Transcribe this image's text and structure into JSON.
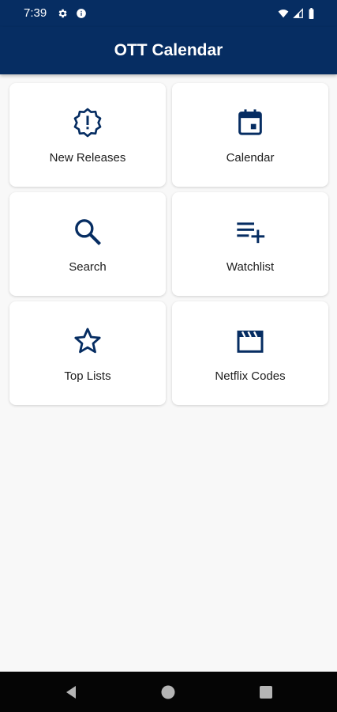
{
  "status_bar": {
    "time": "7:39",
    "left_icons": [
      "settings-icon",
      "info-icon"
    ],
    "right_icons": [
      "wifi-icon",
      "signal-icon",
      "battery-icon"
    ]
  },
  "app_bar": {
    "title": "OTT Calendar",
    "color": "#062d62"
  },
  "tiles": [
    {
      "label": "New Releases",
      "icon": "new-releases-icon"
    },
    {
      "label": "Calendar",
      "icon": "calendar-icon"
    },
    {
      "label": "Search",
      "icon": "search-icon"
    },
    {
      "label": "Watchlist",
      "icon": "playlist-add-icon"
    },
    {
      "label": "Top Lists",
      "icon": "star-icon"
    },
    {
      "label": "Netflix Codes",
      "icon": "clapperboard-icon"
    }
  ],
  "colors": {
    "accent": "#062d62",
    "background": "#f8f8f8",
    "card": "#ffffff"
  },
  "nav_bar": {
    "buttons": [
      "back-icon",
      "home-icon",
      "recents-icon"
    ]
  }
}
